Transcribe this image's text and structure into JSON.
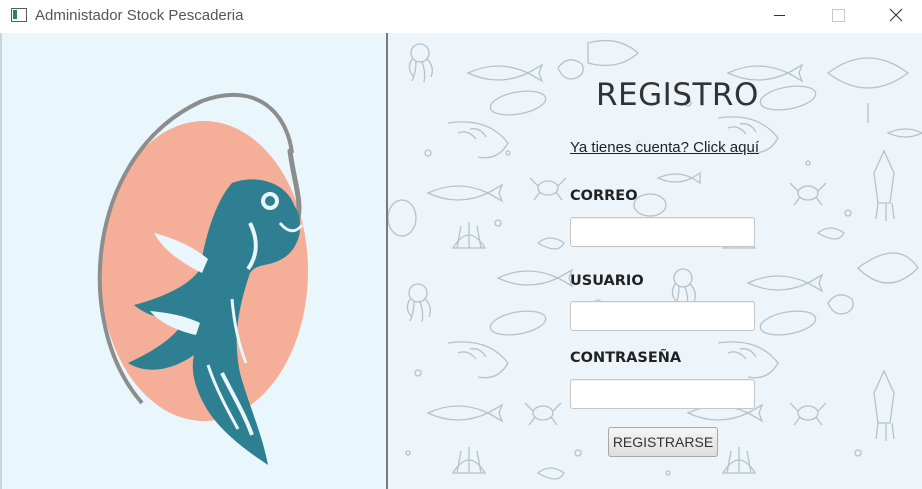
{
  "window": {
    "title": "Administador Stock Pescaderia",
    "icon": "app-window-icon",
    "controls": [
      "minimize",
      "maximize",
      "close"
    ]
  },
  "logo": {
    "icon": "fish-on-hook-logo",
    "colors": {
      "circle": "#f5ae98",
      "fish": "#2e7f91",
      "hook": "#8a8a8a",
      "background": "#e9f6fc"
    }
  },
  "form": {
    "title": "REGISTRO",
    "login_link": "Ya tienes cuenta? Click aquí",
    "email_label": "CORREO",
    "email_value": "",
    "user_label": "USUARIO",
    "user_value": "",
    "password_label": "CONTRASEÑA",
    "password_value": "",
    "submit_label": "REGISTRARSE"
  },
  "background_pattern": {
    "icon": "seafood-doodle-pattern",
    "colors": {
      "base": "#eef5fa",
      "line": "#b4c2cb"
    }
  }
}
